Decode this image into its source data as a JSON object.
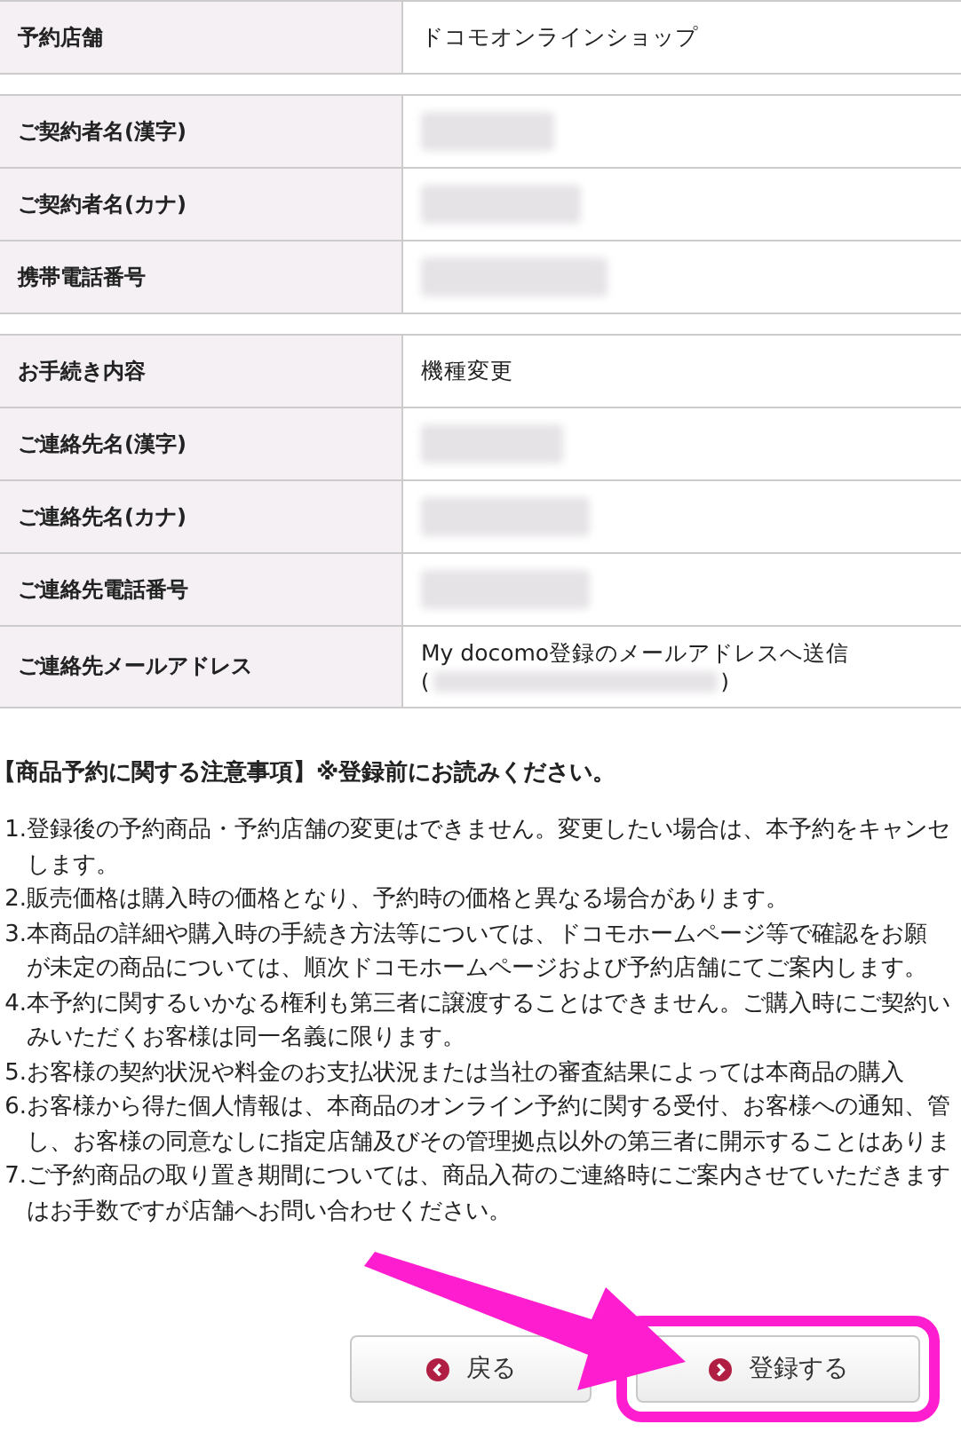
{
  "table_groups": [
    {
      "rows": [
        {
          "label": "予約店舗",
          "kind": "text",
          "value": "ドコモオンラインショップ"
        }
      ]
    },
    {
      "rows": [
        {
          "label": "ご契約者名(漢字)",
          "kind": "redacted"
        },
        {
          "label": "ご契約者名(カナ)",
          "kind": "redacted"
        },
        {
          "label": "携帯電話番号",
          "kind": "redacted"
        }
      ]
    },
    {
      "rows": [
        {
          "label": "お手続き内容",
          "kind": "text",
          "value": "機種変更"
        },
        {
          "label": "ご連絡先名(漢字)",
          "kind": "redacted"
        },
        {
          "label": "ご連絡先名(カナ)",
          "kind": "redacted"
        },
        {
          "label": "ご連絡先電話番号",
          "kind": "redacted"
        },
        {
          "label": "ご連絡先メールアドレス",
          "kind": "email",
          "value": "My docomo登録のメールアドレスへ送信",
          "open": "(",
          "close": ")"
        }
      ]
    }
  ],
  "notes": {
    "heading": "【商品予約に関する注意事項】※登録前にお読みください。",
    "items": [
      {
        "number": "1.",
        "lines": [
          "登録後の予約商品・予約店舗の変更はできません。変更したい場合は、本予約をキャンセ",
          "します。"
        ]
      },
      {
        "number": "2.",
        "lines": [
          "販売価格は購入時の価格となり、予約時の価格と異なる場合があります。"
        ]
      },
      {
        "number": "3.",
        "lines": [
          "本商品の詳細や購入時の手続き方法等については、ドコモホームページ等で確認をお願",
          "が未定の商品については、順次ドコモホームページおよび予約店舗にてご案内します。"
        ]
      },
      {
        "number": "4.",
        "lines": [
          "本予約に関するいかなる権利も第三者に譲渡することはできません。ご購入時にご契約い",
          "みいただくお客様は同一名義に限ります。"
        ]
      },
      {
        "number": "5.",
        "lines": [
          "お客様の契約状況や料金のお支払状況または当社の審査結果によっては本商品の購入"
        ]
      },
      {
        "number": "6.",
        "lines": [
          "お客様から得た個人情報は、本商品のオンライン予約に関する受付、お客様への通知、管",
          "し、お客様の同意なしに指定店舗及びその管理拠点以外の第三者に開示することはありま"
        ]
      },
      {
        "number": "7.",
        "lines": [
          "ご予約商品の取り置き期間については、商品入荷のご連絡時にご案内させていただきます",
          "はお手数ですが店舗へお問い合わせください。"
        ]
      }
    ]
  },
  "buttons": [
    {
      "label": "戻る",
      "kind": "back",
      "highlighted": false
    },
    {
      "label": "登録する",
      "kind": "next",
      "highlighted": true
    }
  ]
}
